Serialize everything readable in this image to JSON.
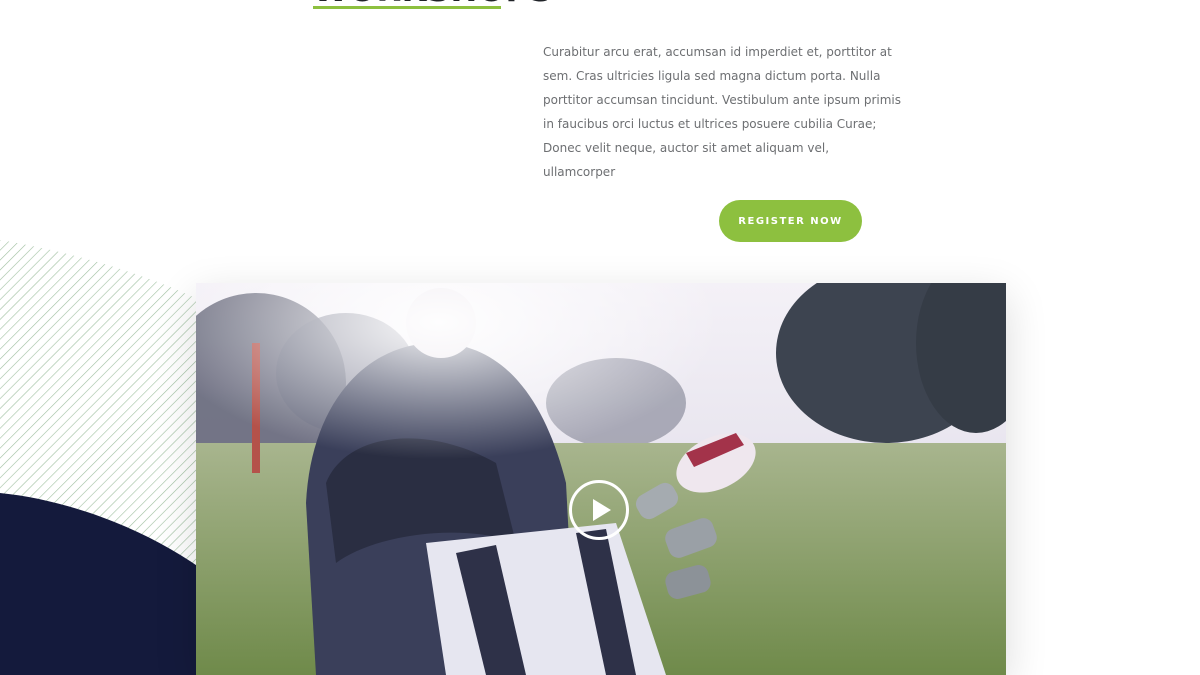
{
  "section": {
    "heading": "WORKSHOPS",
    "body": "Curabitur arcu erat, accumsan id imperdiet et, porttitor at sem. Cras ultricies ligula sed magna dictum porta. Nulla porttitor accumsan tincidunt. Vestibulum ante ipsum primis in faucibus orci luctus et ultrices posuere cubilia Curae; Donec velit neque, auctor sit amet aliquam vel, ullamcorper",
    "cta_label": "REGISTER NOW"
  },
  "video": {
    "icon": "play-icon"
  },
  "colors": {
    "accent": "#8dc03f",
    "navy": "#141a3c",
    "heading": "#1f2227",
    "text": "#6d6f72"
  }
}
